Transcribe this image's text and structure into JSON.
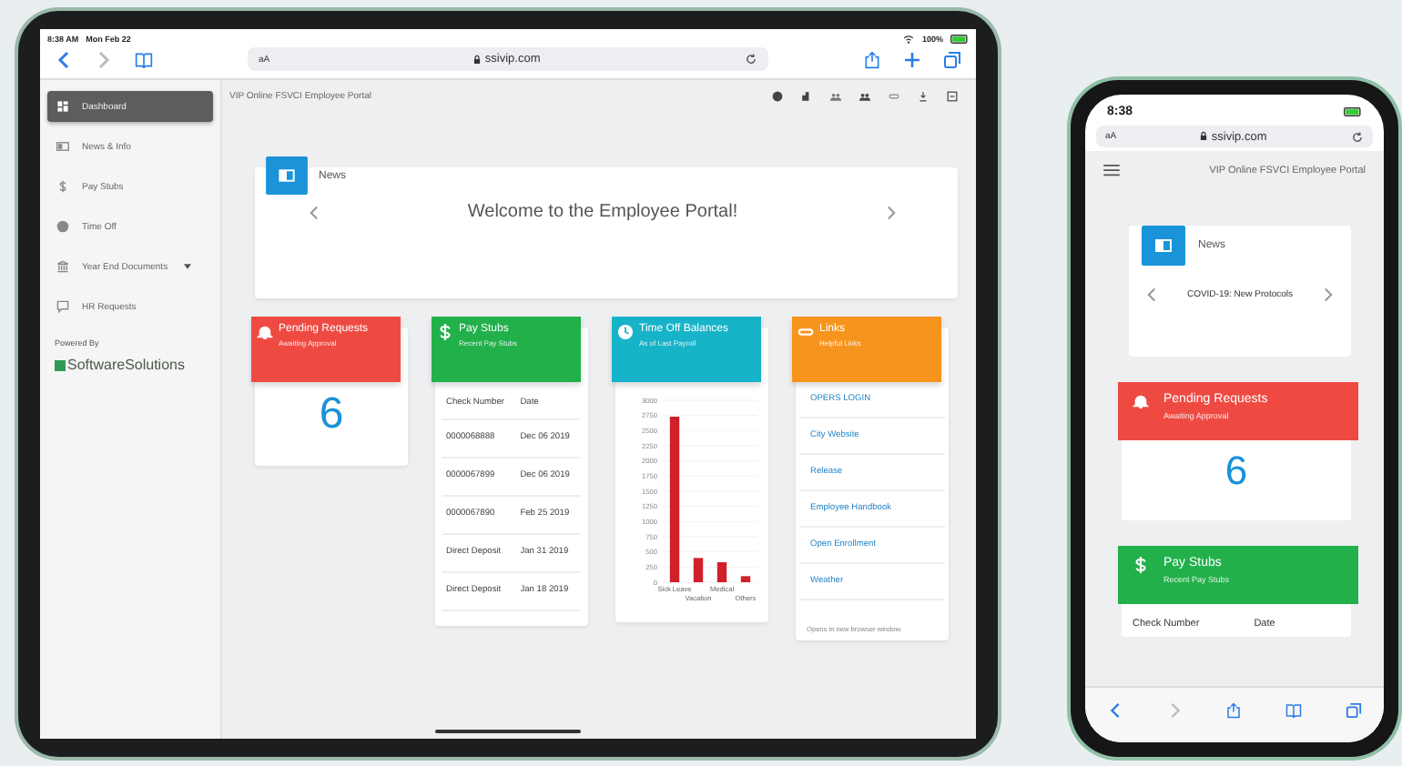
{
  "tablet": {
    "status_bar": {
      "time": "8:38 AM",
      "date": "Mon Feb 22",
      "battery": "100%"
    },
    "browser": {
      "text_size": "aA",
      "address": "ssivip.com"
    },
    "sidebar": {
      "items": [
        {
          "label": "Dashboard",
          "kind": "dashboard",
          "selected": true
        },
        {
          "label": "News & Info",
          "kind": "news",
          "selected": false
        },
        {
          "label": "Pay Stubs",
          "kind": "pay",
          "selected": false
        },
        {
          "label": "Time Off",
          "kind": "time",
          "selected": false
        },
        {
          "label": "Year End Documents",
          "kind": "documents",
          "selected": false,
          "has_menu": true
        },
        {
          "label": "HR Requests",
          "kind": "requests",
          "selected": false
        }
      ],
      "powered_by": "Powered By",
      "brand": "SoftwareSolutions"
    },
    "portal_title": "VIP Online FSVCI Employee Portal",
    "news": {
      "title": "News",
      "message": "Welcome to the Employee Portal!"
    },
    "pending": {
      "title": "Pending Requests",
      "subtitle": "Awaiting Approval",
      "count": "6"
    },
    "pay_stubs": {
      "title": "Pay Stubs",
      "subtitle": "Recent Pay Stubs",
      "columns": [
        "Check Number",
        "Date"
      ],
      "rows": [
        [
          "0000068888",
          "Dec 06 2019"
        ],
        [
          "0000067899",
          "Dec 06 2019"
        ],
        [
          "0000067890",
          "Feb 25 2019"
        ],
        [
          "Direct Deposit",
          "Jan 31 2019"
        ],
        [
          "Direct Deposit",
          "Jan 18 2019"
        ]
      ]
    },
    "time_off": {
      "title": "Time Off Balances",
      "subtitle": "As of Last Payroll",
      "chart_data": {
        "type": "bar",
        "categories": [
          "Sick Leave",
          "Vacation",
          "Medical",
          "Others"
        ],
        "values": [
          2730,
          400,
          330,
          100
        ],
        "grid": true,
        "ylim": [
          0,
          3000
        ],
        "yticks": [
          0,
          250,
          500,
          750,
          1000,
          1250,
          1500,
          1750,
          2000,
          2250,
          2500,
          2750,
          3000
        ]
      }
    },
    "links": {
      "title": "Links",
      "subtitle": "Helpful Links",
      "items": [
        "OPERS LOGIN",
        "City Website",
        "Release",
        "Employee Handbook",
        "Open Enrollment",
        "Weather"
      ],
      "note": "Opens in new browser window."
    }
  },
  "phone": {
    "status_bar": {
      "time": "8:38"
    },
    "browser": {
      "text_size": "aA",
      "address": "ssivip.com"
    },
    "portal_title": "VIP Online FSVCI Employee Portal",
    "news": {
      "title": "News",
      "message": "COVID-19: New Protocols"
    },
    "pending": {
      "title": "Pending Requests",
      "subtitle": "Awaiting Approval",
      "count": "6"
    },
    "pay_stubs": {
      "title": "Pay Stubs",
      "subtitle": "Recent Pay Stubs",
      "columns": [
        "Check Number",
        "Date"
      ]
    }
  }
}
